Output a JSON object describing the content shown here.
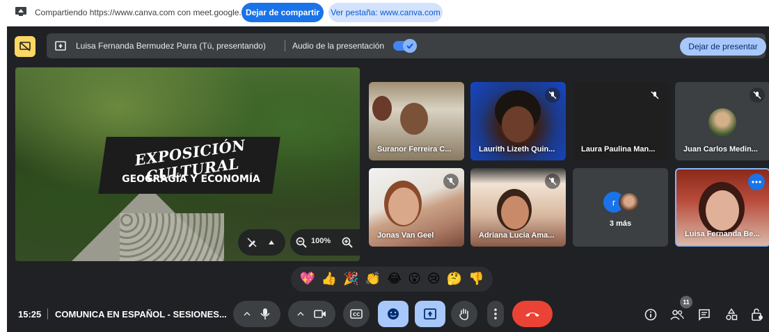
{
  "share_bar": {
    "sharing_text": "Compartiendo https://www.canva.com con meet.google.com",
    "stop_sharing_label": "Dejar de compartir",
    "view_tab_label": "Ver pestaña: www.canva.com"
  },
  "presentation_bar": {
    "presenter_text": "Luisa Fernanda Bermudez Parra (Tú, presentando)",
    "audio_label": "Audio de la presentación",
    "audio_enabled": true,
    "stop_presenting_label": "Dejar de presentar"
  },
  "slide": {
    "title": "EXPOSICIÓN CULTURAL",
    "subtitle": "GEOGRAGÍA Y ECONOMÍA",
    "zoom_level": "100%"
  },
  "participants": [
    {
      "name": "Suranor Ferreira C...",
      "muted": false
    },
    {
      "name": "Laurith Lizeth Quin...",
      "muted": true
    },
    {
      "name": "Laura Paulina Man...",
      "muted": true
    },
    {
      "name": "Juan Carlos Medin...",
      "muted": true
    },
    {
      "name": "Jonas Van Geel",
      "muted": true
    },
    {
      "name": "Adriana Lucia Ama...",
      "muted": true
    },
    {
      "name": "3 más",
      "avatar_letter": "r"
    },
    {
      "name": "Luisa Fernanda Be...",
      "muted": false
    }
  ],
  "reactions": [
    "💖",
    "👍",
    "🎉",
    "👏",
    "😂",
    "😮",
    "😢",
    "🤔",
    "👎"
  ],
  "bottom_bar": {
    "time": "15:25",
    "meeting_name": "COMUNICA EN ESPAÑOL - SESIONES...",
    "participant_count": "11"
  },
  "colors": {
    "meet_background": "#202124",
    "accent_blue": "#1a73e8",
    "leave_red": "#ea4335",
    "active_control": "#a8c7fa"
  }
}
